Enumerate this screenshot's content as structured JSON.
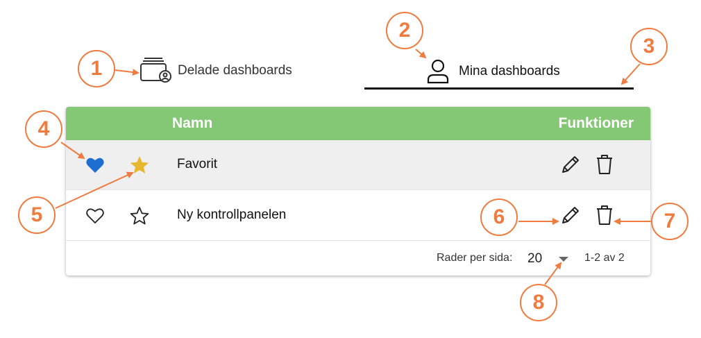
{
  "tabs": {
    "shared": {
      "label": "Delade dashboards",
      "icon": "shared-dashboards-icon"
    },
    "mine": {
      "label": "Mina dashboards",
      "icon": "user-icon",
      "active": true
    }
  },
  "table": {
    "headers": {
      "name": "Namn",
      "functions": "Funktioner"
    },
    "header_color": "#84c774",
    "rows": [
      {
        "name": "Favorit",
        "liked": true,
        "starred": true
      },
      {
        "name": "Ny kontrollpanelen",
        "liked": false,
        "starred": false
      }
    ],
    "footer": {
      "rows_per_page_label": "Rader per sida:",
      "rows_per_page_value": "20",
      "range": "1-2 av 2"
    }
  },
  "colors": {
    "accent": "#f07b3f",
    "heart_filled": "#1c6fd1",
    "star_filled": "#e8b730"
  },
  "callouts": [
    "1",
    "2",
    "3",
    "4",
    "5",
    "6",
    "7",
    "8"
  ]
}
